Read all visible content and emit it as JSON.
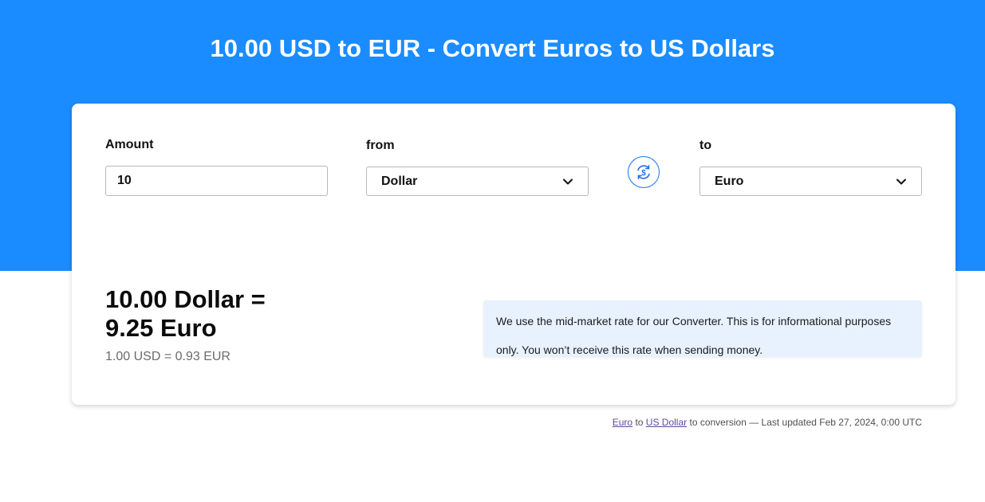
{
  "header": {
    "title": "10.00 USD to EUR - Convert Euros to US Dollars"
  },
  "converter": {
    "amount_label": "Amount",
    "amount_value": "10",
    "from_label": "from",
    "from_selected": "Dollar",
    "to_label": "to",
    "to_selected": "Euro",
    "swap_icon": "currency-exchange-icon"
  },
  "result": {
    "line1": "10.00 Dollar =",
    "line2": "9.25 Euro",
    "rate": "1.00 USD = 0.93 EUR"
  },
  "info": {
    "text": "We use the mid-market rate for our Converter. This is for informational purposes only. You won’t receive this rate when sending money."
  },
  "footer": {
    "link1": "Euro",
    "text1": " to ",
    "link2": "US Dollar",
    "text2": " to conversion — Last updated Feb 27, 2024, 0:00 UTC"
  },
  "colors": {
    "header_bg": "#1a8cff",
    "accent": "#1a73e8",
    "info_bg": "#e8f2ff"
  }
}
